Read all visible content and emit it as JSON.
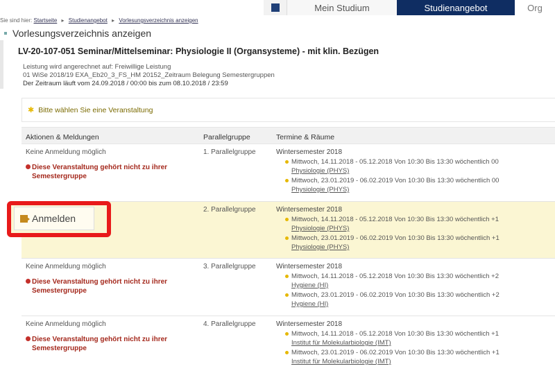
{
  "topnav": {
    "tab_mein_studium": "Mein Studium",
    "tab_studienangebot": "Studienangebot",
    "tab_org": "Org"
  },
  "breadcrumb": {
    "prefix": "Sie sind hier:",
    "items": [
      "Startseite",
      "Studienangebot",
      "Vorlesungsverzeichnis anzeigen"
    ]
  },
  "page_title": "Vorlesungsverzeichnis anzeigen",
  "lv_title": "LV-20-107-051 Seminar/Mittelseminar: Physiologie II (Organsysteme) - mit klin. Bezügen",
  "info": {
    "line1": "Leistung wird angerechnet auf: Freiwillige Leistung",
    "line2": "01 WiSe 2018/19 EXA_Eb20_3_FS_HM 20152_Zeitraum Belegung Semestergruppen",
    "line3": "Der Zeitraum läuft vom 24.09.2018 / 00:00 bis zum 08.10.2018 / 23:59"
  },
  "hint": "Bitte wählen Sie eine Veranstaltung",
  "table": {
    "headers": [
      "Aktionen & Meldungen",
      "Parallelgruppe",
      "Termine & Räume"
    ],
    "rows": [
      {
        "status": "Keine Anmeldung möglich",
        "error": "Diese Veranstaltung gehört nicht zu ihrer Semestergruppe",
        "group": "1. Parallelgruppe",
        "semester": "Wintersemester 2018",
        "term1": "Mittwoch, 14.11.2018 - 05.12.2018 Von 10:30 Bis 13:30 wöchentlich 00",
        "room1": "Physiologie (PHYS)",
        "term2": "Mittwoch, 23.01.2019 - 06.02.2019 Von 10:30 Bis 13:30 wöchentlich 00",
        "room2": "Physiologie (PHYS)"
      },
      {
        "button": "Anmelden",
        "group": "2. Parallelgruppe",
        "semester": "Wintersemester 2018",
        "term1": "Mittwoch, 14.11.2018 - 05.12.2018 Von 10:30 Bis 13:30 wöchentlich +1",
        "room1": "Physiologie (PHYS)",
        "term2": "Mittwoch, 23.01.2019 - 06.02.2019 Von 10:30 Bis 13:30 wöchentlich +1",
        "room2": "Physiologie (PHYS)"
      },
      {
        "status": "Keine Anmeldung möglich",
        "error": "Diese Veranstaltung gehört nicht zu ihrer Semestergruppe",
        "group": "3. Parallelgruppe",
        "semester": "Wintersemester 2018",
        "term1": "Mittwoch, 14.11.2018 - 05.12.2018 Von 10:30 Bis 13:30 wöchentlich +2",
        "room1": "Hygiene (HI)",
        "term2": "Mittwoch, 23.01.2019 - 06.02.2019 Von 10:30 Bis 13:30 wöchentlich +2",
        "room2": "Hygiene (HI)"
      },
      {
        "status": "Keine Anmeldung möglich",
        "error": "Diese Veranstaltung gehört nicht zu ihrer Semestergruppe",
        "group": "4. Parallelgruppe",
        "semester": "Wintersemester 2018",
        "term1": "Mittwoch, 14.11.2018 - 05.12.2018 Von 10:30 Bis 13:30 wöchentlich +1",
        "room1": "Institut für Molekularbiologie (IMT)",
        "term2": "Mittwoch, 23.01.2019 - 06.02.2019 Von 10:30 Bis 13:30 wöchentlich +1",
        "room2": "Institut für Molekularbiologie (IMT)"
      }
    ]
  },
  "colors": {
    "nav_active": "#0f2d62",
    "highlight_row": "#fbf6d3",
    "error_text": "#a4281c",
    "callout_red": "#e81a1a"
  }
}
